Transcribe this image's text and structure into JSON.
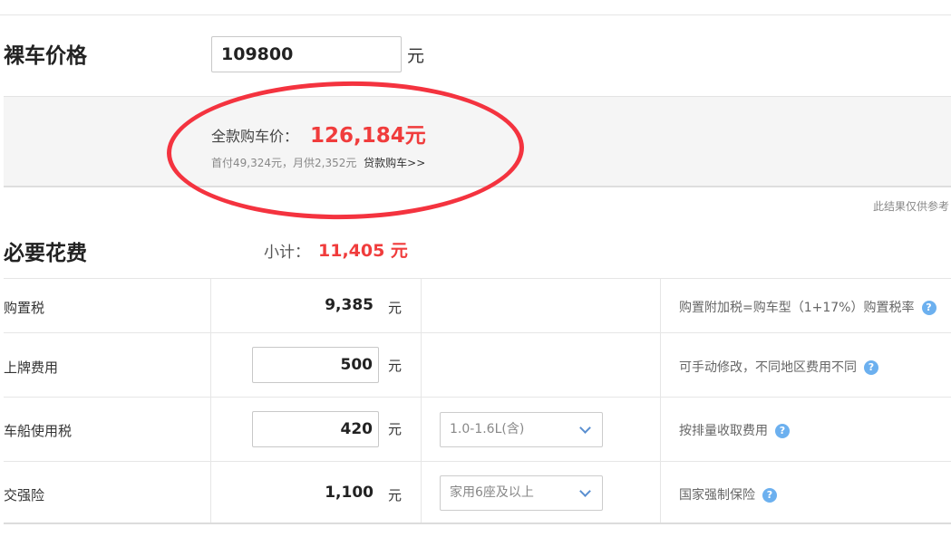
{
  "bare_price": {
    "label": "裸车价格",
    "value": "109800",
    "unit": "元"
  },
  "summary": {
    "total_label": "全款购车价：",
    "total_value": "126,184元",
    "down_payment_text": "首付49,324元，月供2,352元",
    "loan_link": "贷款购车>>",
    "reference_note": "此结果仅供参考"
  },
  "necessary_fees": {
    "title": "必要花费",
    "subtotal_label": "小计：",
    "subtotal_value": "11,405 元",
    "rows": [
      {
        "name": "购置税",
        "amount": "9,385",
        "unit": "元",
        "note": "购置附加税=购车型（1+17%）购置税率",
        "help": "?"
      },
      {
        "name": "上牌费用",
        "amount": "500",
        "unit": "元",
        "note": "可手动修改，不同地区费用不同",
        "help": "?"
      },
      {
        "name": "车船使用税",
        "amount": "420",
        "unit": "元",
        "select": "1.0-1.6L(含)",
        "note": "按排量收取费用",
        "help": "?"
      },
      {
        "name": "交强险",
        "amount": "1,100",
        "unit": "元",
        "select": "家用6座及以上",
        "note": "国家强制保险",
        "help": "?"
      }
    ]
  },
  "colors": {
    "accent_red": "#f03c3c",
    "annotation_circle": "#f4333f",
    "help_blue": "#6cb0ef"
  }
}
